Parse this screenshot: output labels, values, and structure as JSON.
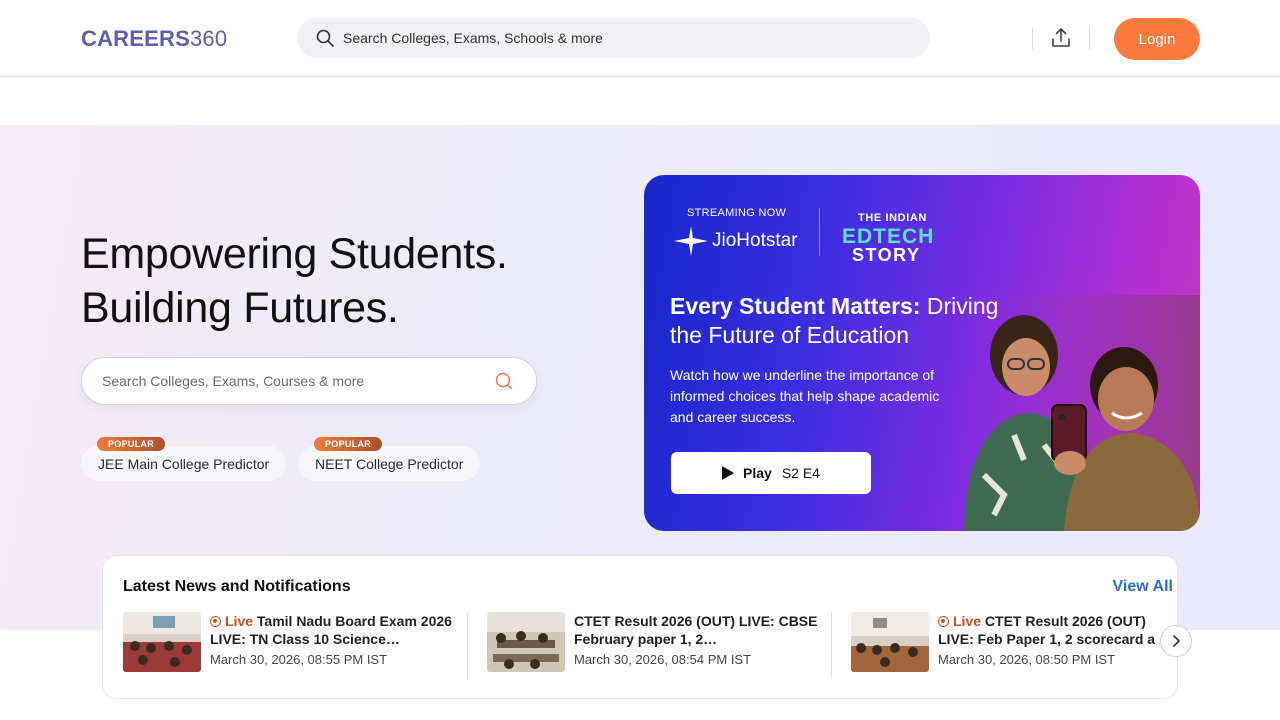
{
  "header": {
    "logo_bold": "CAREERS",
    "logo_light": "360",
    "search_placeholder": "Search Colleges, Exams, Schools & more",
    "login_label": "Login"
  },
  "hero": {
    "title_line1": "Empowering Students.",
    "title_line2": "Building Futures.",
    "search_placeholder": "Search Colleges, Exams, Courses & more",
    "chips": [
      {
        "badge": "POPULAR",
        "label": "JEE Main College Predictor"
      },
      {
        "badge": "POPULAR",
        "label": "NEET College Predictor"
      }
    ]
  },
  "banner": {
    "streaming": "STREAMING NOW",
    "platform": "JioHotstar",
    "show_line1": "THE INDIAN",
    "show_line2": "EDTECH",
    "show_line3": "STORY",
    "heading_bold": "Every Student Matters:",
    "heading_rest": " Driving the Future of Education",
    "description": "Watch how we underline the importance of informed choices that help shape academic and career success.",
    "play_label": "Play",
    "episode": "S2 E4"
  },
  "news": {
    "title": "Latest News and Notifications",
    "view_all": "View All",
    "items": [
      {
        "live": "Live",
        "headline": "Tamil Nadu Board Exam 2026 LIVE: TN Class 10 Science…",
        "date": "March 30, 2026, 08:55 PM IST"
      },
      {
        "live": "",
        "headline": "CTET Result 2026 (OUT) LIVE: CBSE February paper 1, 2…",
        "date": "March 30, 2026, 08:54 PM IST"
      },
      {
        "live": "Live",
        "headline": "CTET Result 2026 (OUT) LIVE: Feb Paper 1, 2 scorecard a",
        "date": "March 30, 2026, 08:50 PM IST"
      }
    ]
  },
  "colors": {
    "accent": "#fb7b3f",
    "brand": "#5b5fae",
    "link": "#2c6ed5",
    "live": "#c4541d"
  }
}
